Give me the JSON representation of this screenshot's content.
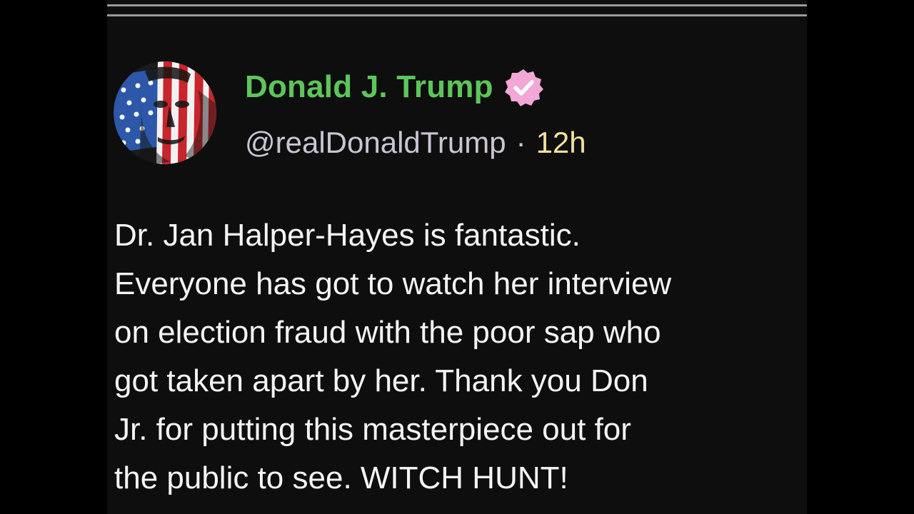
{
  "post": {
    "author": {
      "display_name": "Donald J. Trump",
      "handle": "@realDonaldTrump",
      "verified_icon": "verified-badge-icon",
      "avatar_icon": "flag-portrait-avatar"
    },
    "separator": "·",
    "time_ago": "12h",
    "text_lines": [
      "Dr. Jan Halper-Hayes is fantastic.",
      "Everyone has got to watch her interview",
      "on election fraud with the poor sap who",
      "got taken apart by her. Thank you Don",
      "Jr. for putting this masterpiece out for",
      "the public to see. WITCH HUNT!"
    ]
  },
  "colors": {
    "background": "#0e0e0e",
    "name": "#5cc65a",
    "handle": "#c9c5d3",
    "time": "#f2e29a",
    "text": "#f4f4f4",
    "badge": "#f2a7d6"
  }
}
